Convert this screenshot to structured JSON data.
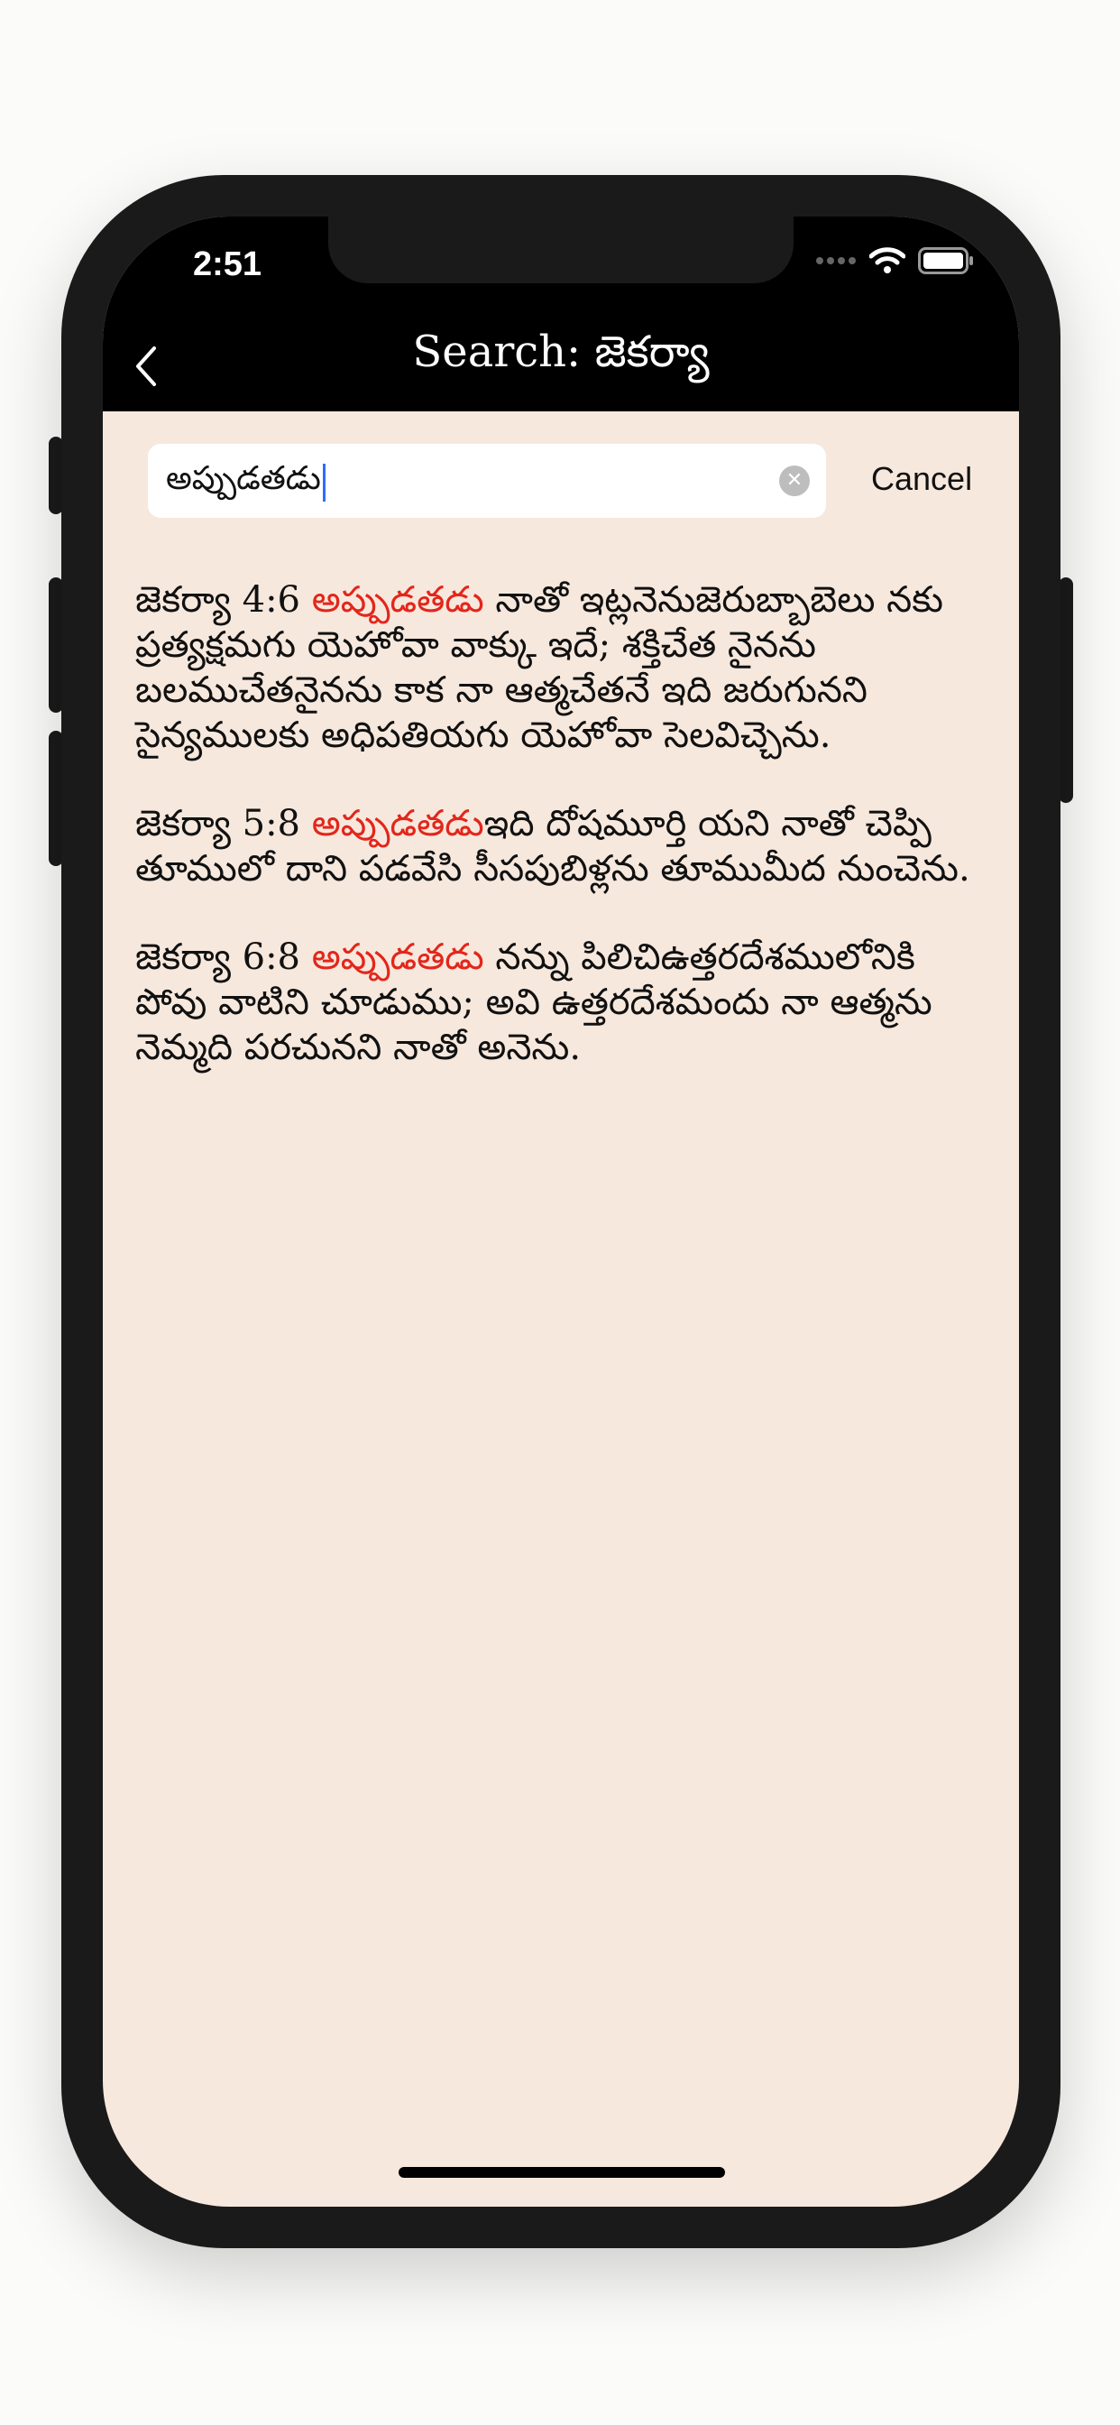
{
  "status_bar": {
    "time": "2:51"
  },
  "nav": {
    "title": "Search: జెకర్యా"
  },
  "search": {
    "value": "అప్పుడతడు",
    "cancel_label": "Cancel"
  },
  "colors": {
    "highlight": "#e3261b",
    "background": "#f7e8dd",
    "nav_bar": "#000000"
  },
  "results": [
    {
      "ref": "జెకర్యా 4:6 ",
      "match": "అప్పుడతడు",
      "text": " నాతో ఇట్లనెనుజెరుబ్బాబెలు నకు ప్రత్యక్షమగు యెహోవా వాక్కు ఇదే; శక్తిచేత నైనను బలముచేతనైనను కాక నా ఆత్మచేతనే ఇది జరుగునని సైన్యములకు అధిపతియగు యెహోవా సెలవిచ్చెను."
    },
    {
      "ref": "జెకర్యా 5:8 ",
      "match": "అప్పుడతడు",
      "text": "ఇది దోషమూర్తి యని నాతో చెప్పి తూములో దాని పడవేసి సీసపుబిళ్లను తూముమీద నుంచెను."
    },
    {
      "ref": "జెకర్యా 6:8 ",
      "match": "అప్పుడతడు",
      "text": " నన్ను పిలిచిఉత్తరదేశములోనికి పోవు వాటిని చూడుము; అవి ఉత్తరదేశమందు నా ఆత్మను నెమ్మది పరచునని నాతో అనెను."
    }
  ]
}
